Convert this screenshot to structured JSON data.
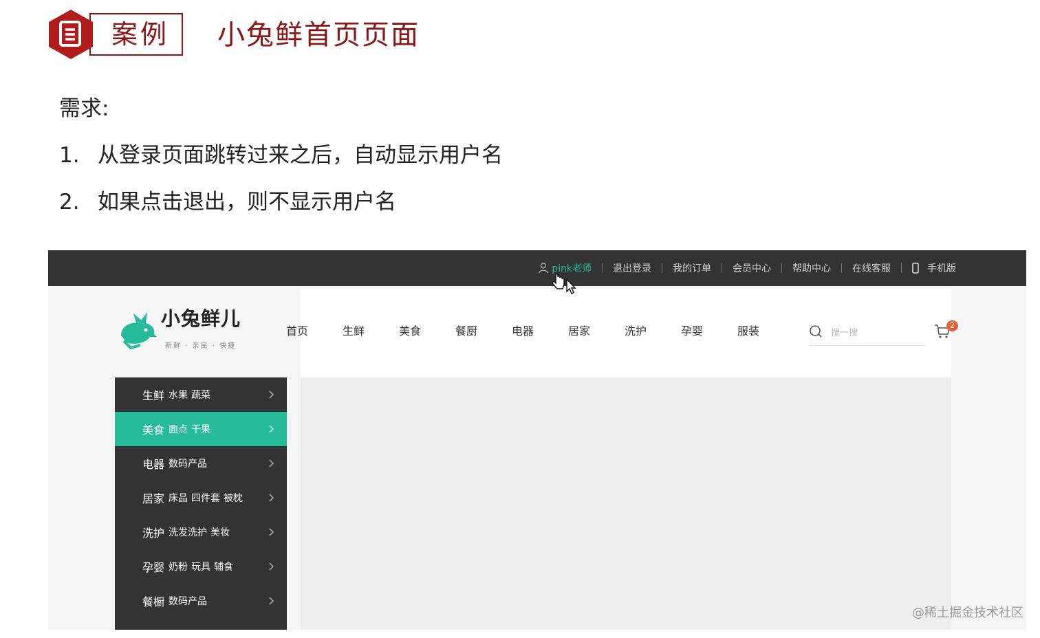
{
  "slide": {
    "badge_label": "案例",
    "title": "小兔鲜首页页面",
    "requirements_heading": "需求:",
    "requirements": [
      {
        "num": "1.",
        "text": "从登录页面跳转过来之后，自动显示用户名"
      },
      {
        "num": "2.",
        "text": "如果点击退出，则不显示用户名"
      }
    ],
    "accent_color": "#8a1515"
  },
  "site": {
    "topbar": {
      "username": "pink老师",
      "links": [
        "退出登录",
        "我的订单",
        "会员中心",
        "帮助中心",
        "在线客服"
      ],
      "mobile_label": "手机版",
      "icons": [
        "user-icon",
        "phone-icon"
      ]
    },
    "logo": {
      "name": "小兔鲜儿",
      "tagline": "新鲜 · 亲民 · 快捷"
    },
    "nav": [
      "首页",
      "生鲜",
      "美食",
      "餐厨",
      "电器",
      "居家",
      "洗护",
      "孕婴",
      "服装"
    ],
    "search": {
      "placeholder": "搜一搜"
    },
    "cart": {
      "count": "2"
    },
    "categories": [
      {
        "main": "生鲜",
        "sub": [
          "水果",
          "蔬菜"
        ],
        "active": false
      },
      {
        "main": "美食",
        "sub": [
          "面点",
          "干果"
        ],
        "active": true
      },
      {
        "main": "电器",
        "sub": [
          "数码产品"
        ],
        "active": false
      },
      {
        "main": "居家",
        "sub": [
          "床品",
          "四件套",
          "被枕"
        ],
        "active": false
      },
      {
        "main": "洗护",
        "sub": [
          "洗发洗护",
          "美妆"
        ],
        "active": false
      },
      {
        "main": "孕婴",
        "sub": [
          "奶粉",
          "玩具",
          "辅食"
        ],
        "active": false
      },
      {
        "main": "餐橱",
        "sub": [
          "数码产品"
        ],
        "active": false
      }
    ],
    "brand_color": "#27ba9b"
  },
  "watermark": "@稀土掘金技术社区"
}
